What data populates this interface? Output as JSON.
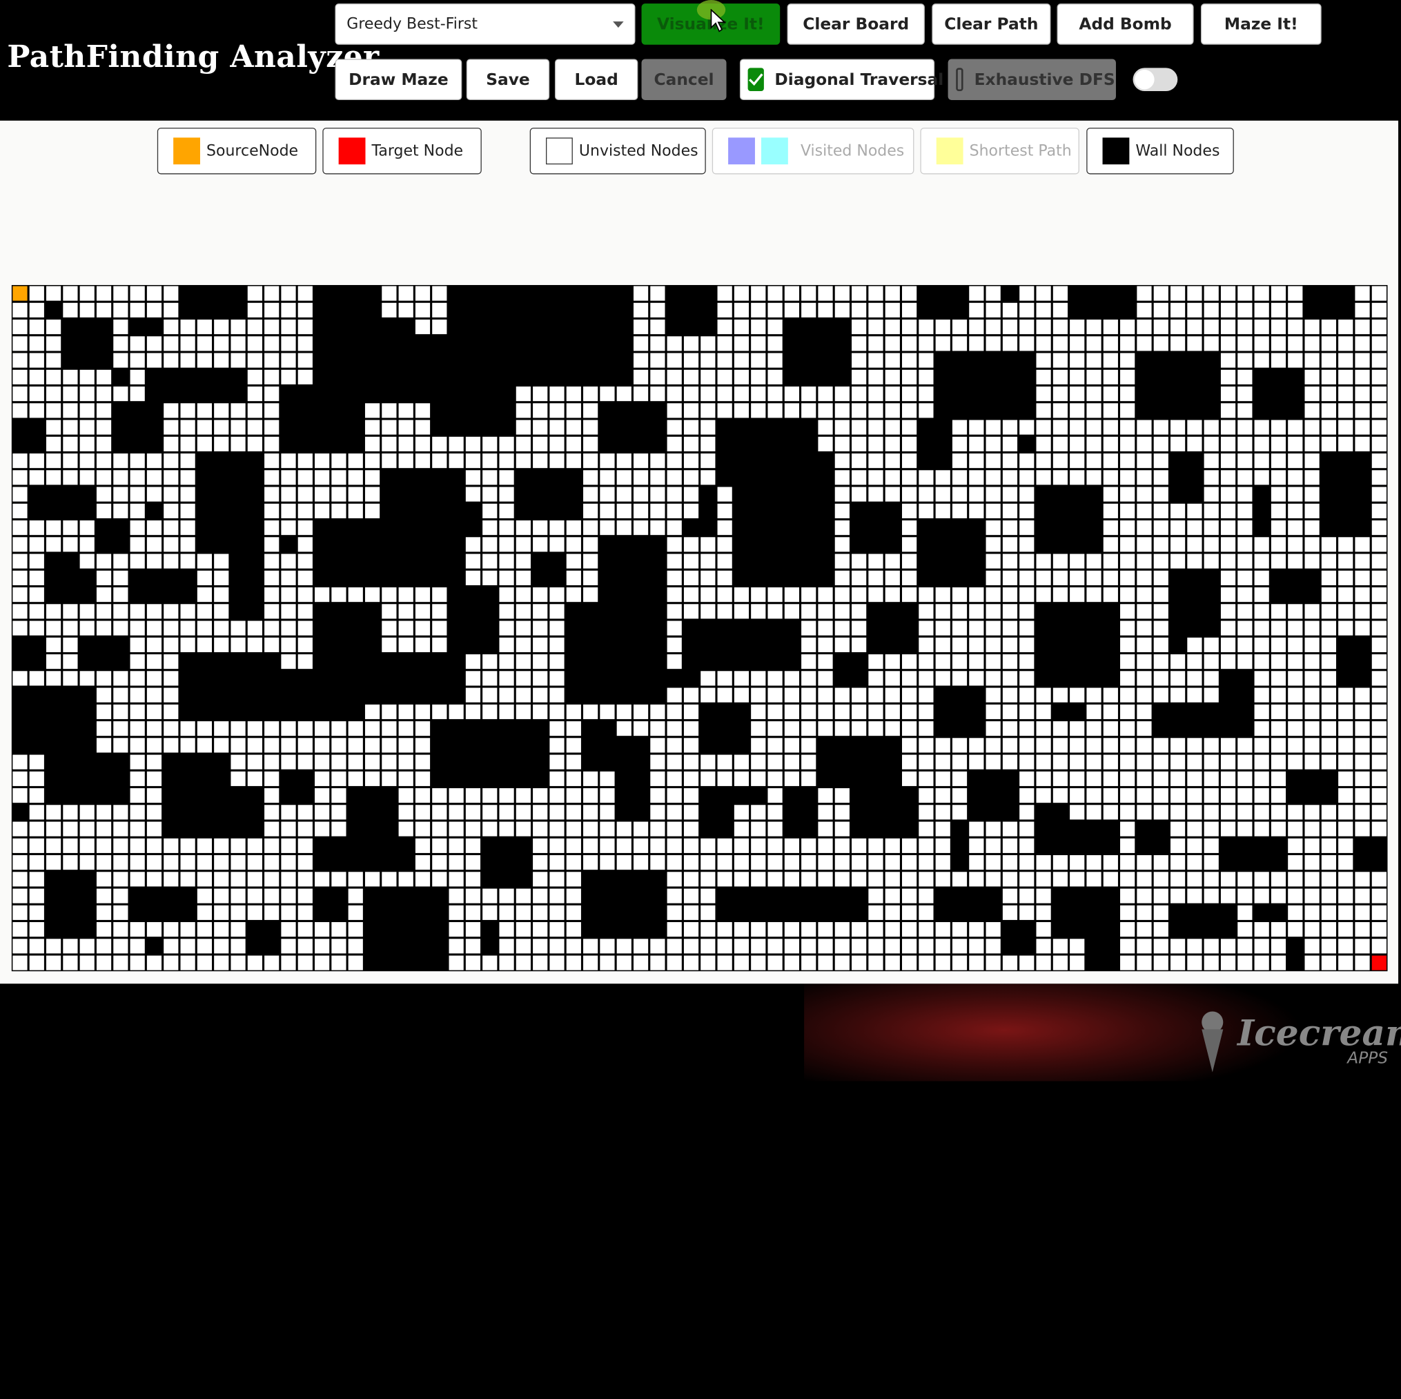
{
  "app": {
    "title": "PathFinding Analyzer"
  },
  "toolbar": {
    "algorithm_select": {
      "value": "Greedy Best-First"
    },
    "visualize_label": "Visualize It!",
    "clear_board_label": "Clear Board",
    "clear_path_label": "Clear Path",
    "add_bomb_label": "Add Bomb",
    "maze_it_label": "Maze It!",
    "draw_maze_label": "Draw Maze",
    "save_label": "Save",
    "load_label": "Load",
    "cancel_label": "Cancel",
    "diagonal_traversal": {
      "label": "Diagonal Traversal",
      "checked": true
    },
    "exhaustive_dfs": {
      "label": "Exhaustive DFS",
      "checked": false
    },
    "toggle_on": false
  },
  "legend": {
    "source": {
      "label": "SourceNode",
      "color": "#ffa500"
    },
    "target": {
      "label": "Target Node",
      "color": "#ff0000"
    },
    "unvisited": {
      "label": "Unvisted Nodes",
      "color": "#ffffff"
    },
    "visited": {
      "label": "Visited Nodes",
      "colors": [
        "#9999ff",
        "#99ffff"
      ]
    },
    "shortest": {
      "label": "Shortest Path",
      "color": "#ffff99"
    },
    "wall": {
      "label": "Wall Nodes",
      "color": "#000000"
    }
  },
  "grid": {
    "rows": 41,
    "cols": 82,
    "source": [
      0,
      0
    ],
    "target": [
      40,
      81
    ],
    "wall_blocks": [
      [
        1,
        2,
        1,
        1
      ],
      [
        0,
        10,
        2,
        4
      ],
      [
        0,
        18,
        3,
        4
      ],
      [
        0,
        26,
        6,
        11
      ],
      [
        0,
        39,
        3,
        3
      ],
      [
        0,
        54,
        2,
        3
      ],
      [
        0,
        59,
        1,
        1
      ],
      [
        0,
        63,
        2,
        4
      ],
      [
        0,
        77,
        2,
        3
      ],
      [
        2,
        3,
        3,
        3
      ],
      [
        2,
        7,
        1,
        2
      ],
      [
        3,
        18,
        4,
        8
      ],
      [
        2,
        20,
        4,
        4
      ],
      [
        2,
        46,
        4,
        4
      ],
      [
        2,
        30,
        3,
        3
      ],
      [
        5,
        8,
        2,
        6
      ],
      [
        5,
        6,
        1,
        1
      ],
      [
        4,
        55,
        4,
        6
      ],
      [
        4,
        67,
        4,
        5
      ],
      [
        5,
        74,
        3,
        3
      ],
      [
        6,
        16,
        4,
        5
      ],
      [
        6,
        25,
        3,
        5
      ],
      [
        7,
        6,
        3,
        3
      ],
      [
        7,
        35,
        3,
        4
      ],
      [
        8,
        0,
        2,
        2
      ],
      [
        8,
        54,
        3,
        2
      ],
      [
        8,
        42,
        4,
        6
      ],
      [
        9,
        60,
        1,
        1
      ],
      [
        10,
        78,
        5,
        3
      ],
      [
        10,
        11,
        6,
        4
      ],
      [
        10,
        43,
        8,
        6
      ],
      [
        10,
        69,
        3,
        2
      ],
      [
        11,
        22,
        7,
        5
      ],
      [
        11,
        30,
        3,
        4
      ],
      [
        12,
        1,
        2,
        4
      ],
      [
        12,
        61,
        4,
        4
      ],
      [
        12,
        74,
        3,
        1
      ],
      [
        12,
        41,
        3,
        1
      ],
      [
        13,
        8,
        1,
        1
      ],
      [
        13,
        27,
        2,
        1
      ],
      [
        13,
        50,
        3,
        3
      ],
      [
        14,
        18,
        4,
        6
      ],
      [
        14,
        5,
        2,
        2
      ],
      [
        14,
        40,
        1,
        2
      ],
      [
        14,
        54,
        4,
        4
      ],
      [
        15,
        35,
        4,
        4
      ],
      [
        15,
        16,
        1,
        1
      ],
      [
        16,
        2,
        1,
        2
      ],
      [
        16,
        31,
        2,
        2
      ],
      [
        16,
        13,
        4,
        2
      ],
      [
        17,
        7,
        2,
        4
      ],
      [
        17,
        2,
        2,
        3
      ],
      [
        17,
        69,
        4,
        3
      ],
      [
        17,
        75,
        2,
        3
      ],
      [
        18,
        26,
        4,
        3
      ],
      [
        19,
        61,
        5,
        5
      ],
      [
        19,
        18,
        4,
        4
      ],
      [
        19,
        33,
        6,
        6
      ],
      [
        19,
        51,
        3,
        3
      ],
      [
        20,
        40,
        3,
        7
      ],
      [
        21,
        0,
        2,
        2
      ],
      [
        21,
        4,
        2,
        3
      ],
      [
        21,
        79,
        3,
        2
      ],
      [
        21,
        69,
        1,
        1
      ],
      [
        22,
        49,
        2,
        2
      ],
      [
        22,
        10,
        4,
        6
      ],
      [
        22,
        21,
        3,
        6
      ],
      [
        23,
        15,
        3,
        6
      ],
      [
        23,
        39,
        1,
        2
      ],
      [
        23,
        72,
        4,
        2
      ],
      [
        24,
        0,
        4,
        5
      ],
      [
        24,
        55,
        3,
        3
      ],
      [
        25,
        41,
        3,
        3
      ],
      [
        25,
        68,
        2,
        4
      ],
      [
        25,
        62,
        1,
        2
      ],
      [
        26,
        34,
        3,
        2
      ],
      [
        26,
        25,
        4,
        7
      ],
      [
        27,
        36,
        3,
        2
      ],
      [
        27,
        48,
        3,
        5
      ],
      [
        28,
        2,
        3,
        5
      ],
      [
        28,
        9,
        5,
        4
      ],
      [
        29,
        16,
        2,
        2
      ],
      [
        29,
        57,
        3,
        3
      ],
      [
        29,
        76,
        2,
        3
      ],
      [
        30,
        12,
        3,
        3
      ],
      [
        30,
        20,
        3,
        3
      ],
      [
        30,
        36,
        2,
        2
      ],
      [
        30,
        41,
        3,
        2
      ],
      [
        30,
        43,
        1,
        2
      ],
      [
        30,
        46,
        3,
        2
      ],
      [
        30,
        50,
        3,
        4
      ],
      [
        31,
        0,
        1,
        1
      ],
      [
        31,
        61,
        3,
        2
      ],
      [
        32,
        56,
        3,
        1
      ],
      [
        32,
        63,
        2,
        3
      ],
      [
        32,
        67,
        2,
        2
      ],
      [
        33,
        72,
        2,
        4
      ],
      [
        33,
        28,
        3,
        3
      ],
      [
        33,
        18,
        2,
        6
      ],
      [
        33,
        80,
        2,
        2
      ],
      [
        35,
        2,
        4,
        3
      ],
      [
        35,
        34,
        4,
        5
      ],
      [
        36,
        7,
        2,
        4
      ],
      [
        36,
        21,
        5,
        5
      ],
      [
        36,
        42,
        2,
        4
      ],
      [
        36,
        46,
        2,
        5
      ],
      [
        36,
        55,
        2,
        4
      ],
      [
        36,
        18,
        2,
        2
      ],
      [
        36,
        62,
        3,
        4
      ],
      [
        37,
        69,
        2,
        4
      ],
      [
        37,
        74,
        1,
        2
      ],
      [
        38,
        14,
        2,
        2
      ],
      [
        38,
        28,
        2,
        1
      ],
      [
        38,
        59,
        2,
        2
      ],
      [
        38,
        64,
        3,
        2
      ],
      [
        39,
        8,
        1,
        1
      ],
      [
        39,
        76,
        1,
        1
      ],
      [
        40,
        76,
        1,
        1
      ]
    ]
  }
}
